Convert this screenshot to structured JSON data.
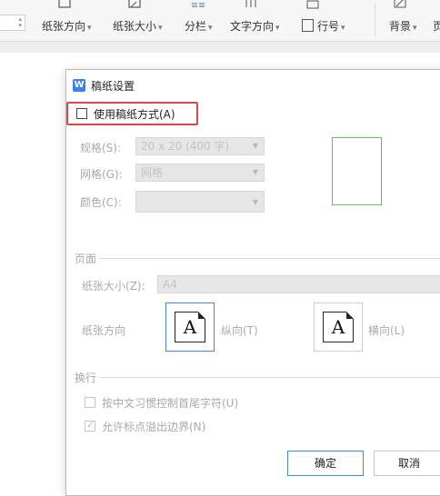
{
  "ribbon": {
    "paper_direction": "纸张方向",
    "paper_size": "纸张大小",
    "columns": "分栏",
    "text_direction": "文字方向",
    "line_number": "行号",
    "background": "背景",
    "page_partial": "页",
    "caret": "▾"
  },
  "dialog": {
    "title": "稿纸设置",
    "use_manuscript_label": "使用稿纸方式(A)",
    "spec_label": "规格(S):",
    "spec_value": "20 x 20 (400 字)",
    "grid_label": "网格(G):",
    "grid_value": "网格",
    "color_label": "颜色(C):",
    "color_value": "",
    "page_group": "页面",
    "paper_size_label": "纸张大小(Z):",
    "paper_size_value": "A4",
    "orientation_label": "纸张方向",
    "portrait_label": "纵向(T)",
    "landscape_label": "横向(L)",
    "orientation_glyph": "A",
    "linebreak_group": "换行",
    "opt_chinese_rule": "按中文习惯控制首尾字符(U)",
    "opt_allow_overflow": "允许标点溢出边界(N)",
    "ok_button": "确定",
    "cancel_button_partial": "取消"
  },
  "colors": {
    "highlight_border": "#d94a4a",
    "preview_border": "#67c267",
    "selected_border": "#4a86d4",
    "app_icon": "#3d82e6"
  }
}
